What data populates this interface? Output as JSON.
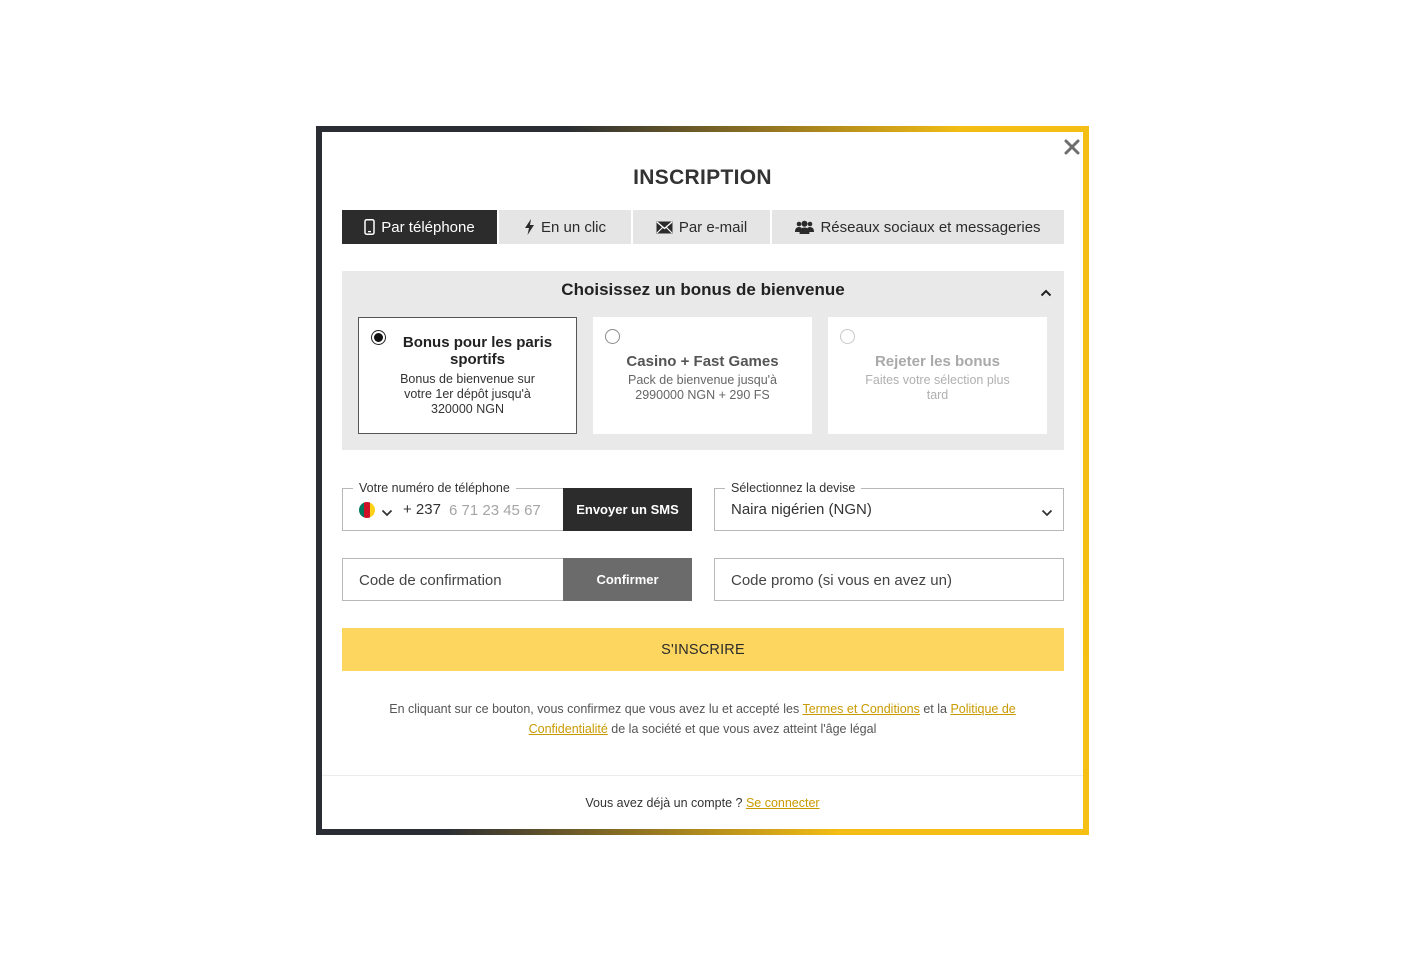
{
  "modal": {
    "title": "INSCRIPTION",
    "close_icon": "close-icon"
  },
  "tabs": [
    {
      "label": "Par téléphone",
      "icon": "mobile-phone-icon",
      "active": true
    },
    {
      "label": "En un clic",
      "icon": "lightning-bolt-icon",
      "active": false
    },
    {
      "label": "Par e-mail",
      "icon": "envelope-icon",
      "active": false
    },
    {
      "label": "Réseaux sociaux et messageries",
      "icon": "users-group-icon",
      "active": false
    }
  ],
  "bonus": {
    "title": "Choisissez un bonus de bienvenue",
    "collapse_icon": "chevron-up-icon",
    "options": [
      {
        "name": "Bonus pour les paris sportifs",
        "description": "Bonus de bienvenue sur votre 1er dépôt jusqu'à 320000 NGN",
        "selected": true
      },
      {
        "name": "Casino + Fast Games",
        "description": "Pack de bienvenue jusqu'à 2990000 NGN + 290 FS",
        "selected": false
      },
      {
        "name": "Rejeter les bonus",
        "description": "Faites votre sélection plus tard",
        "selected": false
      }
    ]
  },
  "phone": {
    "label": "Votre numéro de téléphone",
    "country_flag": "cameroon-flag-icon",
    "flag_colors": [
      "#007a5e",
      "#ce1126",
      "#fcd116"
    ],
    "dial_code": "+ 237",
    "placeholder": "6 71 23 45 67",
    "send_sms_label": "Envoyer un SMS"
  },
  "currency": {
    "label": "Sélectionnez la devise",
    "value": "Naira nigérien (NGN)"
  },
  "confirmation": {
    "placeholder": "Code de confirmation",
    "confirm_label": "Confirmer"
  },
  "promo": {
    "placeholder": "Code promo (si vous en avez un)"
  },
  "register_label": "S'INSCRIRE",
  "legal": {
    "text_before": "En cliquant sur ce bouton, vous confirmez que vous avez lu et accepté les ",
    "terms_link": "Termes et Conditions",
    "text_middle": " et la ",
    "privacy_link": "Politique de Confidentialité",
    "text_after": " de la société et que vous avez atteint l'âge légal"
  },
  "login": {
    "question": "Vous avez déjà un compte ?",
    "link": "Se connecter"
  },
  "colors": {
    "accent_yellow": "#fdd660",
    "link_gold": "#c99a00",
    "dark": "#2c2c2c"
  }
}
